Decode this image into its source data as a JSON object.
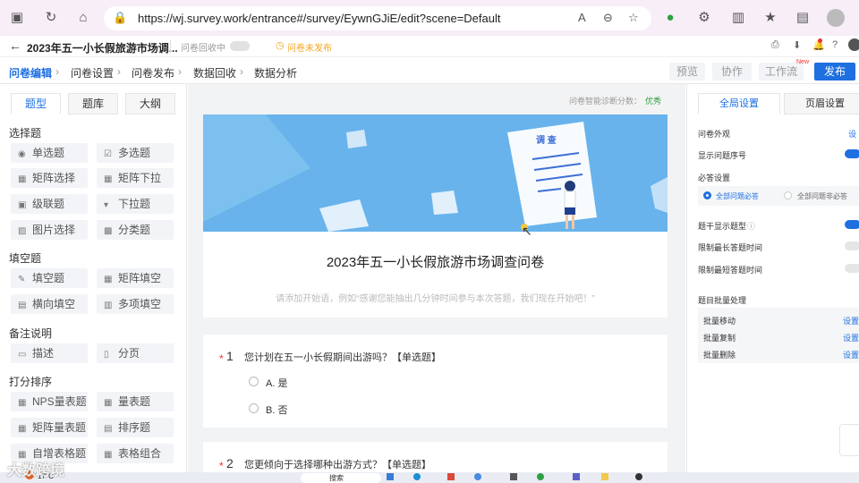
{
  "browser": {
    "url": "https://wj.survey.work/entrance#/survey/EywnGJiE/edit?scene=Default"
  },
  "app": {
    "survey_title": "2023年五一小长假旅游市场调...",
    "collect_label": "问卷回收中",
    "status_label": "问卷未发布"
  },
  "nav": {
    "tabs": [
      "问卷编辑",
      "问卷设置",
      "问卷发布",
      "数据回收",
      "数据分析"
    ],
    "preview": "预览",
    "collab": "协作",
    "workflow": "工作流",
    "workflow_badge": "New",
    "publish": "发布"
  },
  "left": {
    "tabs": [
      "题型",
      "题库",
      "大纲"
    ],
    "sections": [
      {
        "title": "选择题",
        "items": [
          "单选题",
          "多选题",
          "矩阵选择",
          "矩阵下拉",
          "级联题",
          "下拉题",
          "图片选择",
          "分类题"
        ]
      },
      {
        "title": "填空题",
        "items": [
          "填空题",
          "矩阵填空",
          "横向填空",
          "多项填空"
        ]
      },
      {
        "title": "备注说明",
        "items": [
          "描述",
          "分页"
        ]
      },
      {
        "title": "打分排序",
        "items": [
          "NPS量表题",
          "量表题",
          "矩阵量表题",
          "排序题",
          "自增表格题",
          "表格组合"
        ]
      }
    ]
  },
  "canvas": {
    "diagnosis_label": "问卷智能诊断分数：",
    "diagnosis_value": "优秀",
    "banner_doc_text": "调 查",
    "survey_title": "2023年五一小长假旅游市场调查问卷",
    "intro_placeholder": "请添加开始语，例如“感谢您能抽出几分钟时间参与本次答题，我们现在开始吧！”",
    "questions": [
      {
        "required": "*",
        "num": "1",
        "text": "您计划在五一小长假期间出游吗？【单选题】",
        "options": [
          "A. 是",
          "B. 否"
        ]
      },
      {
        "required": "*",
        "num": "2",
        "text": "您更倾向于选择哪种出游方式？【单选题】",
        "options": []
      }
    ]
  },
  "right": {
    "tabs": [
      "全局设置",
      "页眉设置"
    ],
    "appearance": "问卷外观",
    "appearance_link": "设",
    "show_number": "显示问题序号",
    "required_title": "必答设置",
    "required_all": "全部问题必答",
    "required_none": "全部问题非必答",
    "show_type": "题干显示题型",
    "max_time": "限制最长答题时间",
    "min_time": "限制最短答题时间",
    "batch_title": "题目批量处理",
    "batch": [
      {
        "label": "批量移动",
        "link": "设置"
      },
      {
        "label": "批量复制",
        "link": "设置"
      },
      {
        "label": "批量删除",
        "link": "设置"
      }
    ]
  },
  "taskbar": {
    "weather": "17°C",
    "search": "搜索"
  },
  "watermark": "大数跨境"
}
